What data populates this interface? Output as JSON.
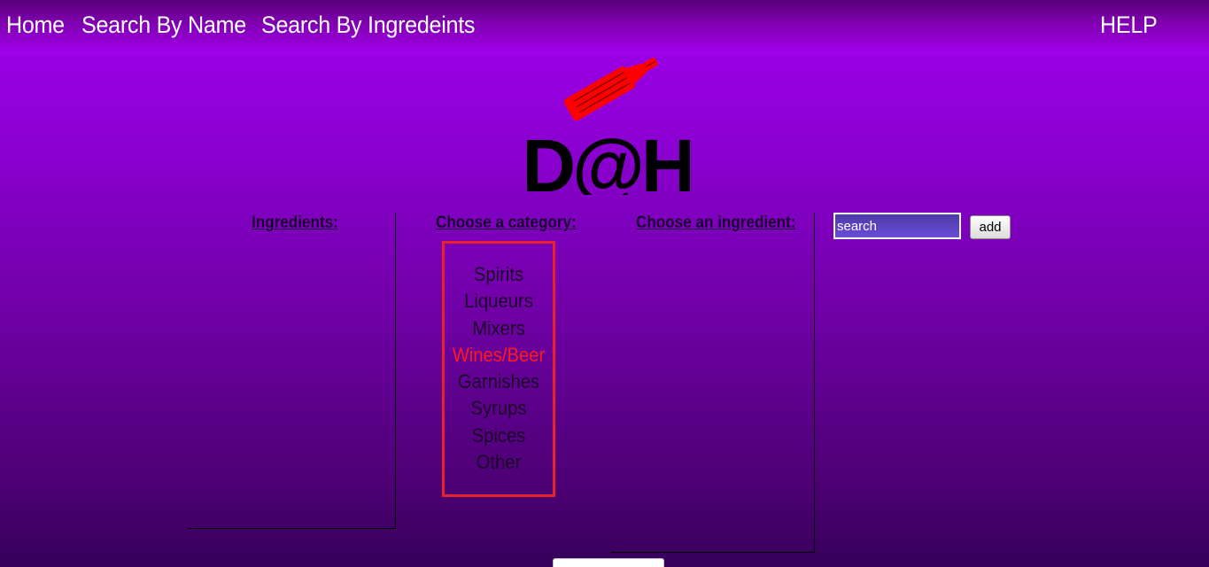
{
  "nav": {
    "home": "Home",
    "search_by_name": "Search By Name",
    "search_by_ingredients": "Search By Ingredeints",
    "help": "HELP"
  },
  "logo": {
    "text": "D@H",
    "icon": "bottle-icon",
    "color_bottle": "#ff0000",
    "color_text": "#000000"
  },
  "columns": {
    "ingredients_header": "Ingredients:",
    "category_header": "Choose a category:",
    "ingredient_header": "Choose an ingredient:"
  },
  "categories": [
    {
      "label": "Spirits",
      "active": false
    },
    {
      "label": "Liqueurs",
      "active": false
    },
    {
      "label": "Mixers",
      "active": false
    },
    {
      "label": "Wines/Beer",
      "active": true
    },
    {
      "label": "Garnishes",
      "active": false
    },
    {
      "label": "Syrups",
      "active": false
    },
    {
      "label": "Spices",
      "active": false
    },
    {
      "label": "Other",
      "active": false
    }
  ],
  "search": {
    "placeholder": "search",
    "add_label": "add"
  },
  "colors": {
    "background_top": "#a100ee",
    "background_bottom": "#36005a",
    "category_border": "#e8222b",
    "active_category": "#ff1a1a"
  }
}
